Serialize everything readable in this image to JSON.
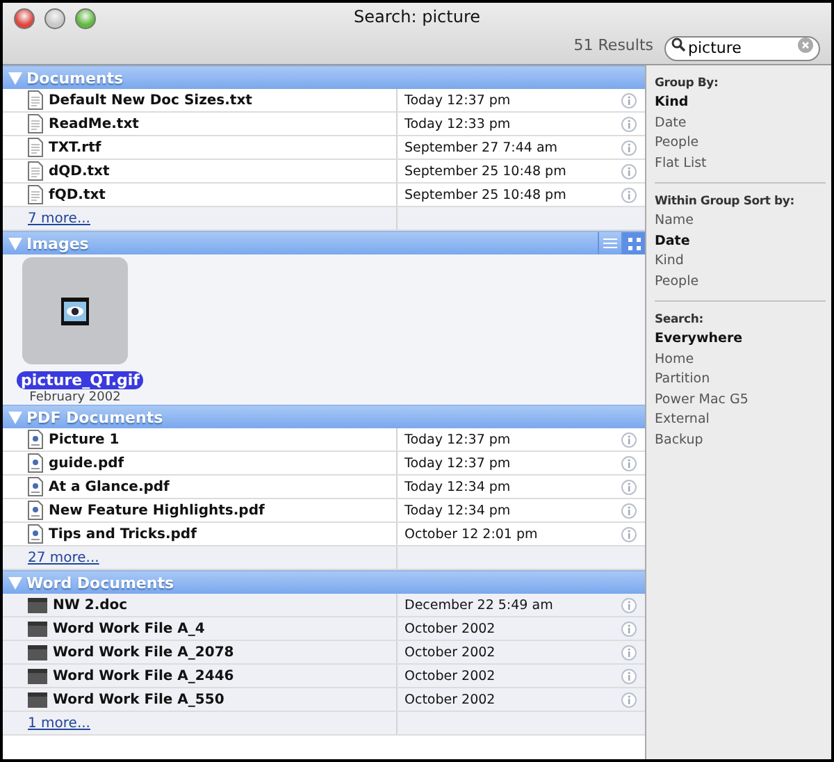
{
  "window": {
    "title": "Search: picture"
  },
  "results": "51 Results",
  "search": {
    "value": "picture"
  },
  "groups": [
    {
      "title": "Documents",
      "expanded": true,
      "kind": "text",
      "more": "7 more...",
      "rows": [
        {
          "name": "Default New Doc Sizes.txt",
          "date": "Today 12:37 pm"
        },
        {
          "name": "ReadMe.txt",
          "date": "Today 12:33 pm"
        },
        {
          "name": "TXT.rtf",
          "date": "September 27 7:44 am"
        },
        {
          "name": "dQD.txt",
          "date": "September 25 10:48 pm"
        },
        {
          "name": "fQD.txt",
          "date": "September 25 10:48 pm"
        }
      ]
    },
    {
      "title": "Images",
      "expanded": true,
      "views": [
        {
          "kind": "list",
          "selected": false
        },
        {
          "kind": "grid",
          "selected": true
        }
      ],
      "items": [
        {
          "name": "picture_QT.gif",
          "date": "February 2002",
          "selected": true
        }
      ]
    },
    {
      "title": "PDF Documents",
      "expanded": true,
      "kind": "pdf",
      "more": "27 more...",
      "rows": [
        {
          "name": "Picture 1",
          "date": "Today 12:37 pm"
        },
        {
          "name": "guide.pdf",
          "date": "Today 12:37 pm"
        },
        {
          "name": "At a Glance.pdf",
          "date": "Today 12:34 pm"
        },
        {
          "name": "New Feature Highlights.pdf",
          "date": "Today 12:34 pm"
        },
        {
          "name": "Tips and Tricks.pdf",
          "date": "October 12 2:01 pm"
        }
      ]
    },
    {
      "title": "Word Documents",
      "expanded": true,
      "kind": "word",
      "more": "1 more...",
      "rows": [
        {
          "name": "NW 2.doc",
          "date": "December 22 5:49 am"
        },
        {
          "name": "Word Work File A_4",
          "date": "October 2002"
        },
        {
          "name": "Word Work File A_2078",
          "date": "October 2002"
        },
        {
          "name": "Word Work File A_2446",
          "date": "October 2002"
        },
        {
          "name": "Word Work File A_550",
          "date": "October 2002"
        }
      ]
    }
  ],
  "sidebar": [
    {
      "heading": "Group By:",
      "options": [
        {
          "label": "Kind",
          "selected": true
        },
        {
          "label": "Date",
          "selected": false
        },
        {
          "label": "People",
          "selected": false
        },
        {
          "label": "Flat List",
          "selected": false
        }
      ]
    },
    {
      "heading": "Within Group Sort by:",
      "options": [
        {
          "label": "Name",
          "selected": false
        },
        {
          "label": "Date",
          "selected": true
        },
        {
          "label": "Kind",
          "selected": false
        },
        {
          "label": "People",
          "selected": false
        }
      ]
    },
    {
      "heading": "Search:",
      "options": [
        {
          "label": "Everywhere",
          "selected": true
        },
        {
          "label": "Home",
          "selected": false
        },
        {
          "label": "Partition",
          "selected": false
        },
        {
          "label": "Power Mac G5",
          "selected": false
        },
        {
          "label": "External",
          "selected": false
        },
        {
          "label": "Backup",
          "selected": false
        }
      ]
    }
  ]
}
